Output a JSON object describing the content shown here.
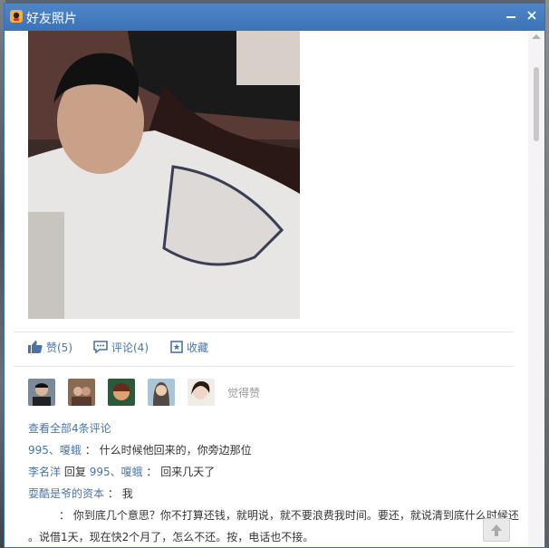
{
  "window": {
    "title": "好友照片"
  },
  "actions": {
    "like_label": "赞(5)",
    "comment_label": "评论(4)",
    "favorite_label": "收藏"
  },
  "likes": {
    "suffix": "觉得赞"
  },
  "comments": {
    "view_all": "查看全部4条评论",
    "items": [
      {
        "author": "995、嗄蛾",
        "sep": "：",
        "text": "什么时候他回来的，你旁边那位"
      },
      {
        "author": "李名洋",
        "reply_word": "回复",
        "reply_to": "995、嗄蛾",
        "sep": "：",
        "text": "回来几天了"
      },
      {
        "author": "耍酷是爷的资本",
        "sep": "：",
        "text": "我"
      }
    ],
    "long_text_line1": "：  你到底几个意思？你不打算还钱，就明说，就不要浪费我时间。要还，就说清到底什么时候还",
    "long_text_line2": "。说借1天，现在快2个月了，怎么不还。按，电话也不接。"
  },
  "colors": {
    "titlebar": "#3c73b8",
    "link": "#4a74a8"
  }
}
